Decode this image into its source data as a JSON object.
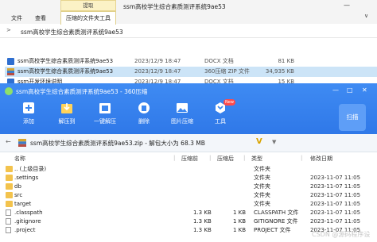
{
  "explorer": {
    "ribbon_tabs": [
      "文件",
      "查看"
    ],
    "context_header": "提取",
    "active_tab": "压缩的文件夹工具",
    "title": "ssm高校学生综合素质测评系统9ae53",
    "minimize": "—",
    "chevron": "∨",
    "address": {
      "arrow": ">",
      "path": "ssm高校学生综合素质测评系统9ae53"
    },
    "files": [
      {
        "name": "ssm高校学生综合素质测评系统9ae53",
        "date": "2023/12/9 18:47",
        "type": "DOCX 文档",
        "size": "81 KB",
        "icon": "doc"
      },
      {
        "name": "ssm高校学生综合素质测评系统9ae53",
        "date": "2023/12/9 18:47",
        "type": "360压缩 ZIP 文件",
        "size": "34,935 KB",
        "icon": "zip"
      },
      {
        "name": "ssm开发环境说明",
        "date": "2023/12/9 18:47",
        "type": "DOCX 文档",
        "size": "15 KB",
        "icon": "doc"
      }
    ]
  },
  "zip": {
    "title": "ssm高校学生综合素质测评系统9ae53 - 360压缩",
    "window_controls": [
      "—",
      "□",
      "✕"
    ],
    "toolbar": [
      {
        "label": "添加",
        "icon": "add-icon"
      },
      {
        "label": "解压到",
        "icon": "extract-to-icon"
      },
      {
        "label": "一键解压",
        "icon": "one-click-extract-icon"
      },
      {
        "label": "删除",
        "icon": "delete-icon"
      },
      {
        "label": "图片压缩",
        "icon": "image-compress-icon"
      },
      {
        "label": "工具",
        "icon": "tools-icon",
        "badge": "New"
      }
    ],
    "scan_label": "扫描",
    "path_text": "ssm高校学生综合素质测评系统9ae53.zip - 解包大小为 68.3 MB",
    "v_label": "V",
    "headers": [
      "名称",
      "压缩前",
      "压缩后",
      "类型",
      "修改日期"
    ],
    "rows": [
      {
        "name": ".. (上级目录)",
        "size": "",
        "csize": "",
        "type": "文件夹",
        "date": "",
        "icon": "folder"
      },
      {
        "name": ".settings",
        "size": "",
        "csize": "",
        "type": "文件夹",
        "date": "2023-11-07 11:05",
        "icon": "folder"
      },
      {
        "name": "db",
        "size": "",
        "csize": "",
        "type": "文件夹",
        "date": "2023-11-07 11:05",
        "icon": "folder"
      },
      {
        "name": "src",
        "size": "",
        "csize": "",
        "type": "文件夹",
        "date": "2023-11-07 11:05",
        "icon": "folder"
      },
      {
        "name": "target",
        "size": "",
        "csize": "",
        "type": "文件夹",
        "date": "2023-11-07 11:05",
        "icon": "folder"
      },
      {
        "name": ".classpath",
        "size": "1.3 KB",
        "csize": "1 KB",
        "type": "CLASSPATH 文件",
        "date": "2023-11-07 11:05",
        "icon": "file"
      },
      {
        "name": ".gitignore",
        "size": "1.3 KB",
        "csize": "1 KB",
        "type": "GITIGNORE 文件",
        "date": "2023-11-07 11:05",
        "icon": "file"
      },
      {
        "name": ".project",
        "size": "1.3 KB",
        "csize": "1 KB",
        "type": "PROJECT 文件",
        "date": "2023-11-07 11:05",
        "icon": "file"
      }
    ],
    "watermark": "CSDN @源码程序设"
  }
}
